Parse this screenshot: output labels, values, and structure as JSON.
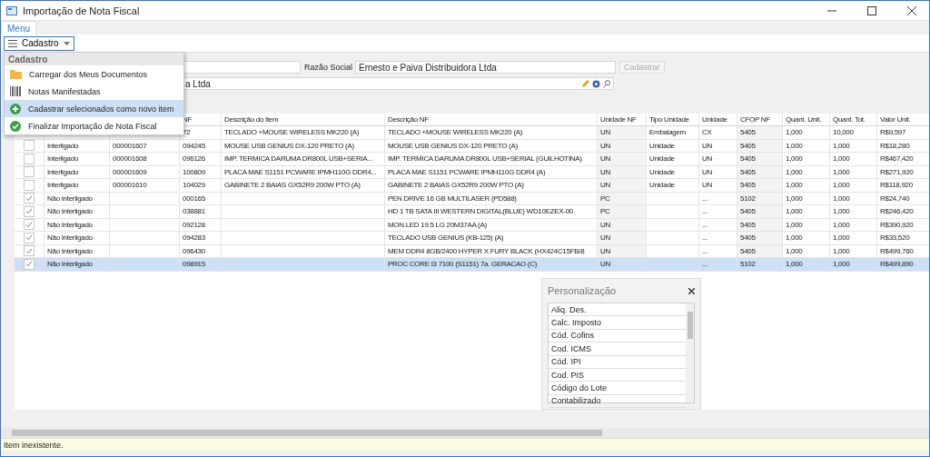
{
  "window": {
    "title": "Importação de Nota Fiscal"
  },
  "tabs": [
    {
      "label": "Menu",
      "selected": true
    }
  ],
  "toolbar": {
    "button": "Cadastro",
    "open": true
  },
  "dropdown": {
    "header": "Cadastro",
    "items": [
      {
        "label": "Carregar dos Meus Documentos",
        "kind": "folder",
        "selected": false
      },
      {
        "label": "Notas Manifestadas",
        "kind": "barcode",
        "selected": false
      },
      {
        "label": "Cadastrar selecionados como novo item",
        "kind": "add",
        "selected": true
      },
      {
        "label": "Finalizar Importação de Nota Fiscal",
        "kind": "done",
        "selected": false
      }
    ]
  },
  "form": {
    "razao_social_label": "Razão Social",
    "razao_social": "Ernesto e Paiva Distribuidora Ltda",
    "cadastrar_button": {
      "label": "Cadastrar",
      "disabled": true
    },
    "fornecedor": "a Ltda"
  },
  "table": {
    "columns": [
      null,
      null,
      "NF",
      "Descrição do Item",
      "Descrição NF",
      "Unidade NF",
      "Tipo Unidade",
      "Unidade",
      "CFOP NF",
      "Quant. Unit.",
      "Quant. Tot.",
      "Valor Unit."
    ],
    "rows": [
      {
        "selected": false,
        "cells": [
          null,
          null,
          "72",
          "TECLADO +MOUSE WIRELESS MK220  (A)",
          "TECLADO +MOUSE WIRELESS MK220  (A)",
          "UN",
          "Embalagem",
          "CX",
          "5405",
          "1,000",
          "10,000",
          "R$9,597"
        ]
      },
      {
        "checked": false,
        "selected": false,
        "cells": [
          "Interligado",
          "000001607",
          "094245",
          "MOUSE USB GENIUS DX-120 PRETO  (A)",
          "MOUSE USB GENIUS DX-120 PRETO  (A)",
          "UN",
          "Unidade",
          "UN",
          "5405",
          "1,000",
          "1,000",
          "R$18,280"
        ]
      },
      {
        "checked": false,
        "selected": false,
        "cells": [
          "Interligado",
          "000001608",
          "096126",
          "IMP. TERMICA DARUMA DR800L USB+SERIA...",
          "IMP. TERMICA DARUMA DR800L USB+SERIAL (GUILHOTINA)",
          "UN",
          "Unidade",
          "UN",
          "5405",
          "1,000",
          "1,000",
          "R$467,420"
        ]
      },
      {
        "checked": false,
        "selected": false,
        "cells": [
          "Interligado",
          "000001609",
          "100809",
          "PLACA MAE S1151 PCWARE IPMH110G DDR4...",
          "PLACA MAE S1151 PCWARE IPMH110G DDR4  (A)",
          "UN",
          "Unidade",
          "UN",
          "5405",
          "1,000",
          "1,000",
          "R$271,920"
        ]
      },
      {
        "checked": false,
        "selected": false,
        "cells": [
          "Interligado",
          "000001610",
          "104029",
          "GABINETE 2 BAIAS GX52R9 200W PTO  (A)",
          "GABINETE 2 BAIAS GX52R9 200W PTO  (A)",
          "UN",
          "Unidade",
          "UN",
          "5405",
          "1,000",
          "1,000",
          "R$118,920"
        ]
      },
      {
        "checked": true,
        "selected": false,
        "cells": [
          "Não Interligado",
          null,
          "000165",
          null,
          "PEN DRIVE 16 GB MULTILASER (PD588)",
          "PC",
          null,
          "...",
          "5102",
          "1,000",
          "1,000",
          "R$24,740"
        ]
      },
      {
        "checked": true,
        "selected": false,
        "cells": [
          "Não Interligado",
          null,
          "038881",
          null,
          "HD 1 TB SATA III WESTERN DIGITAL(BLUE) WD10EZEX-00",
          "PC",
          null,
          "...",
          "5405",
          "1,000",
          "1,000",
          "R$246,420"
        ]
      },
      {
        "checked": true,
        "selected": false,
        "cells": [
          "Não Interligado",
          null,
          "092128",
          null,
          "MON.LED 19.5 LG 20M37AA  (A)",
          "UN",
          null,
          "...",
          "5405",
          "1,000",
          "1,000",
          "R$390,920"
        ]
      },
      {
        "checked": true,
        "selected": false,
        "cells": [
          "Não Interligado",
          null,
          "094283",
          null,
          "TECLADO USB GENIUS (KB-125)  (A)",
          "UN",
          null,
          "...",
          "5405",
          "1,000",
          "1,000",
          "R$33,520"
        ]
      },
      {
        "checked": true,
        "selected": false,
        "cells": [
          "Não Interligado",
          null,
          "096430",
          null,
          "MEM DDR4 8GB/2400 HYPER X FURY BLACK (HX424C15FB/8",
          "UN",
          null,
          "...",
          "5405",
          "1,000",
          "1,000",
          "R$499,760"
        ]
      },
      {
        "checked": true,
        "selected": true,
        "cells": [
          "Não Interligado",
          null,
          "098915",
          null,
          "PROC CORE I3 7100 (S1151) 7a. GERACAO  (C)",
          "UN",
          null,
          "...",
          "5102",
          "1,000",
          "1,000",
          "R$499,890"
        ]
      }
    ]
  },
  "customization": {
    "title": "Personalização",
    "items": [
      "Aliq. Des.",
      "Calc. Imposto",
      "Cód. Cofins",
      "Cod. ICMS",
      "Cód. IPI",
      "Cod. PIS",
      "Código do Lote",
      "Contabilizado"
    ]
  },
  "status_bar": {
    "text": "Item inexistente."
  }
}
